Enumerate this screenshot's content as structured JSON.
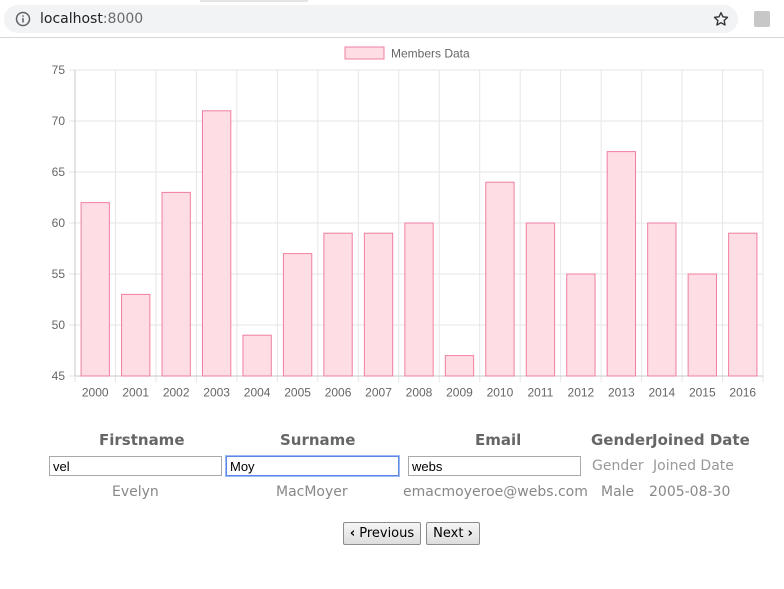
{
  "browser": {
    "url_host": "localhost",
    "url_port": ":8000"
  },
  "chart_data": {
    "type": "bar",
    "legend": "Members Data",
    "legend_position": "top",
    "categories": [
      "2000",
      "2001",
      "2002",
      "2003",
      "2004",
      "2005",
      "2006",
      "2007",
      "2008",
      "2009",
      "2010",
      "2011",
      "2012",
      "2013",
      "2014",
      "2015",
      "2016"
    ],
    "values": [
      62,
      53,
      63,
      71,
      49,
      57,
      59,
      59,
      60,
      47,
      64,
      60,
      55,
      67,
      60,
      55,
      59
    ],
    "ylim": [
      45,
      75
    ],
    "yticks": [
      45,
      50,
      55,
      60,
      65,
      70,
      75
    ],
    "grid": true,
    "bar_fill": "#ffdde4",
    "bar_stroke": "#f07fa0"
  },
  "table": {
    "headers": {
      "firstname": "Firstname",
      "surname": "Surname",
      "email": "Email",
      "gender": "Gender",
      "joined": "Joined Date"
    },
    "filters": {
      "firstname": "vel",
      "surname": "Moy",
      "email": "webs",
      "gender_placeholder": "Gender",
      "joined_placeholder": "Joined Date"
    },
    "rows": [
      {
        "firstname": "Evelyn",
        "surname": "MacMoyer",
        "email": "emacmoyeroe@webs.com",
        "gender": "Male",
        "joined": "2005-08-30"
      }
    ]
  },
  "pagination": {
    "previous": "Previous",
    "next": "Next"
  },
  "icons": {
    "info": "info-icon",
    "star": "star-icon",
    "chevron_left": "‹",
    "chevron_right": "›"
  }
}
